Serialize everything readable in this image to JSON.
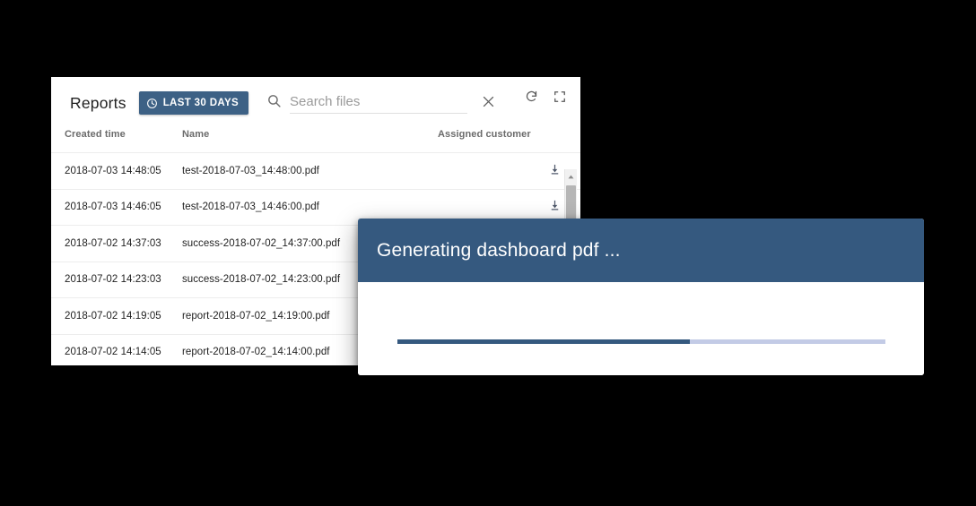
{
  "reports_card": {
    "toolbar": {
      "title": "Reports",
      "timewindow_label": "LAST 30 DAYS",
      "timewindow_icon": "clock-icon",
      "search_icon": "search-icon",
      "search_value": "",
      "search_placeholder": "Search files",
      "clear_icon": "close-icon",
      "refresh_icon": "refresh-icon",
      "fullscreen_icon": "fullscreen-icon"
    },
    "table": {
      "columns": [
        "Created time",
        "Name",
        "Assigned customer",
        ""
      ],
      "row_action_icons": [
        "download-icon",
        "delete-icon"
      ],
      "rows": [
        {
          "created_time": "2018-07-03 14:48:05",
          "name": "test-2018-07-03_14:48:00.pdf",
          "assigned_customer": ""
        },
        {
          "created_time": "2018-07-03 14:46:05",
          "name": "test-2018-07-03_14:46:00.pdf",
          "assigned_customer": ""
        },
        {
          "created_time": "2018-07-02 14:37:03",
          "name": "success-2018-07-02_14:37:00.pdf",
          "assigned_customer": ""
        },
        {
          "created_time": "2018-07-02 14:23:03",
          "name": "success-2018-07-02_14:23:00.pdf",
          "assigned_customer": ""
        },
        {
          "created_time": "2018-07-02 14:19:05",
          "name": "report-2018-07-02_14:19:00.pdf",
          "assigned_customer": ""
        },
        {
          "created_time": "2018-07-02 14:14:05",
          "name": "report-2018-07-02_14:14:00.pdf",
          "assigned_customer": ""
        }
      ]
    }
  },
  "progress_dialog": {
    "title": "Generating dashboard pdf ...",
    "progress_percent": 60,
    "progress_percent_css": "60%",
    "header_color": "#35597f",
    "track_color": "#c3cbe6"
  },
  "theme": {
    "accent": "#35597f",
    "button_blue": "#3d6185",
    "background": "#000000"
  }
}
